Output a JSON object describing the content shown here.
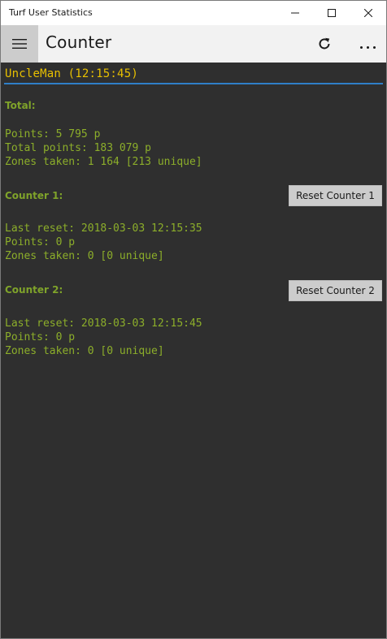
{
  "window": {
    "title": "Turf User Statistics"
  },
  "appbar": {
    "page_title": "Counter"
  },
  "user": {
    "header": "UncleMan (12:15:45)"
  },
  "total": {
    "label": "Total:",
    "points": "Points: 5 795 p",
    "total_points": "Total points: 183 079 p",
    "zones_taken": "Zones taken: 1 164 [213 unique]"
  },
  "counter1": {
    "label": "Counter 1:",
    "reset_label": "Reset Counter 1",
    "last_reset": "Last reset: 2018-03-03 12:15:35",
    "points": "Points: 0 p",
    "zones_taken": "Zones taken: 0 [0 unique]"
  },
  "counter2": {
    "label": "Counter 2:",
    "reset_label": "Reset Counter 2",
    "last_reset": "Last reset: 2018-03-03 12:15:45",
    "points": "Points: 0 p",
    "zones_taken": "Zones taken: 0 [0 unique]"
  },
  "icons": {
    "menu": "hamburger-icon",
    "refresh": "refresh-icon",
    "more": "more-icon",
    "minimize": "minimize-icon",
    "maximize": "maximize-icon",
    "close": "close-icon"
  },
  "colors": {
    "background": "#2f2f2f",
    "header_yellow": "#e8c000",
    "accent_blue": "#2f7fc8",
    "label_green": "#7fa32a",
    "text_green": "#8cae2a",
    "button_gray": "#cccccc"
  }
}
